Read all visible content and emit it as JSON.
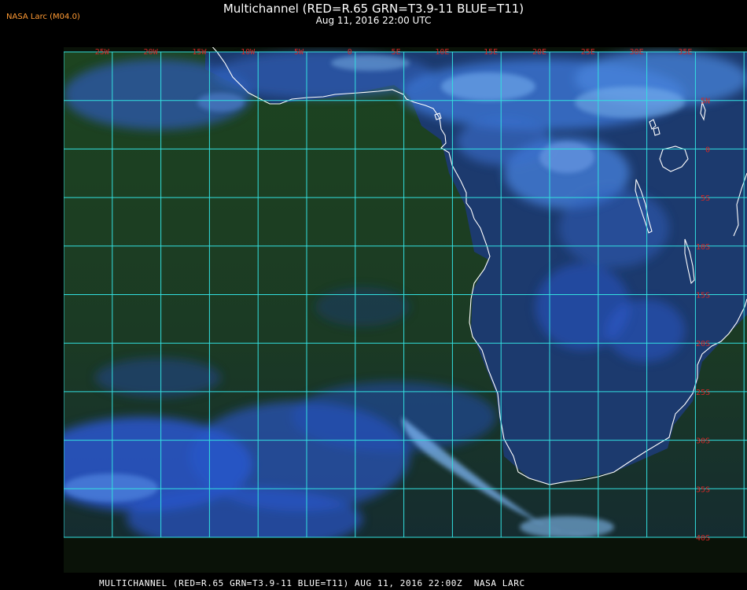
{
  "header": {
    "title": "Multichannel (RED=R.65 GRN=T3.9-11 BLUE=T11)",
    "date": "Aug 11, 2016 22:00 UTC"
  },
  "producer_label": "NASA Larc (M04.0)",
  "footer": "MULTICHANNEL (RED=R.65 GRN=T3.9-11 BLUE=T11) AUG 11, 2016 22:00Z  NASA LARC",
  "grid": {
    "longitude_labels": [
      "25W",
      "20W",
      "15W",
      "10W",
      "5W",
      "0",
      "5E",
      "10E",
      "15E",
      "20E",
      "25E",
      "30E",
      "35E"
    ],
    "latitude_labels": [
      "5N",
      "0",
      "5S",
      "10S",
      "15S",
      "20S",
      "25S",
      "30S",
      "35S",
      "40S"
    ],
    "grid_color": "#33e0e0",
    "label_color": "#d02828"
  },
  "colors": {
    "ocean": "#1e3f1e",
    "land": "#1c3870",
    "cloud": "#2a60e0",
    "bright_cloud": "#6aa6f0",
    "coastline": "#ffffff"
  }
}
